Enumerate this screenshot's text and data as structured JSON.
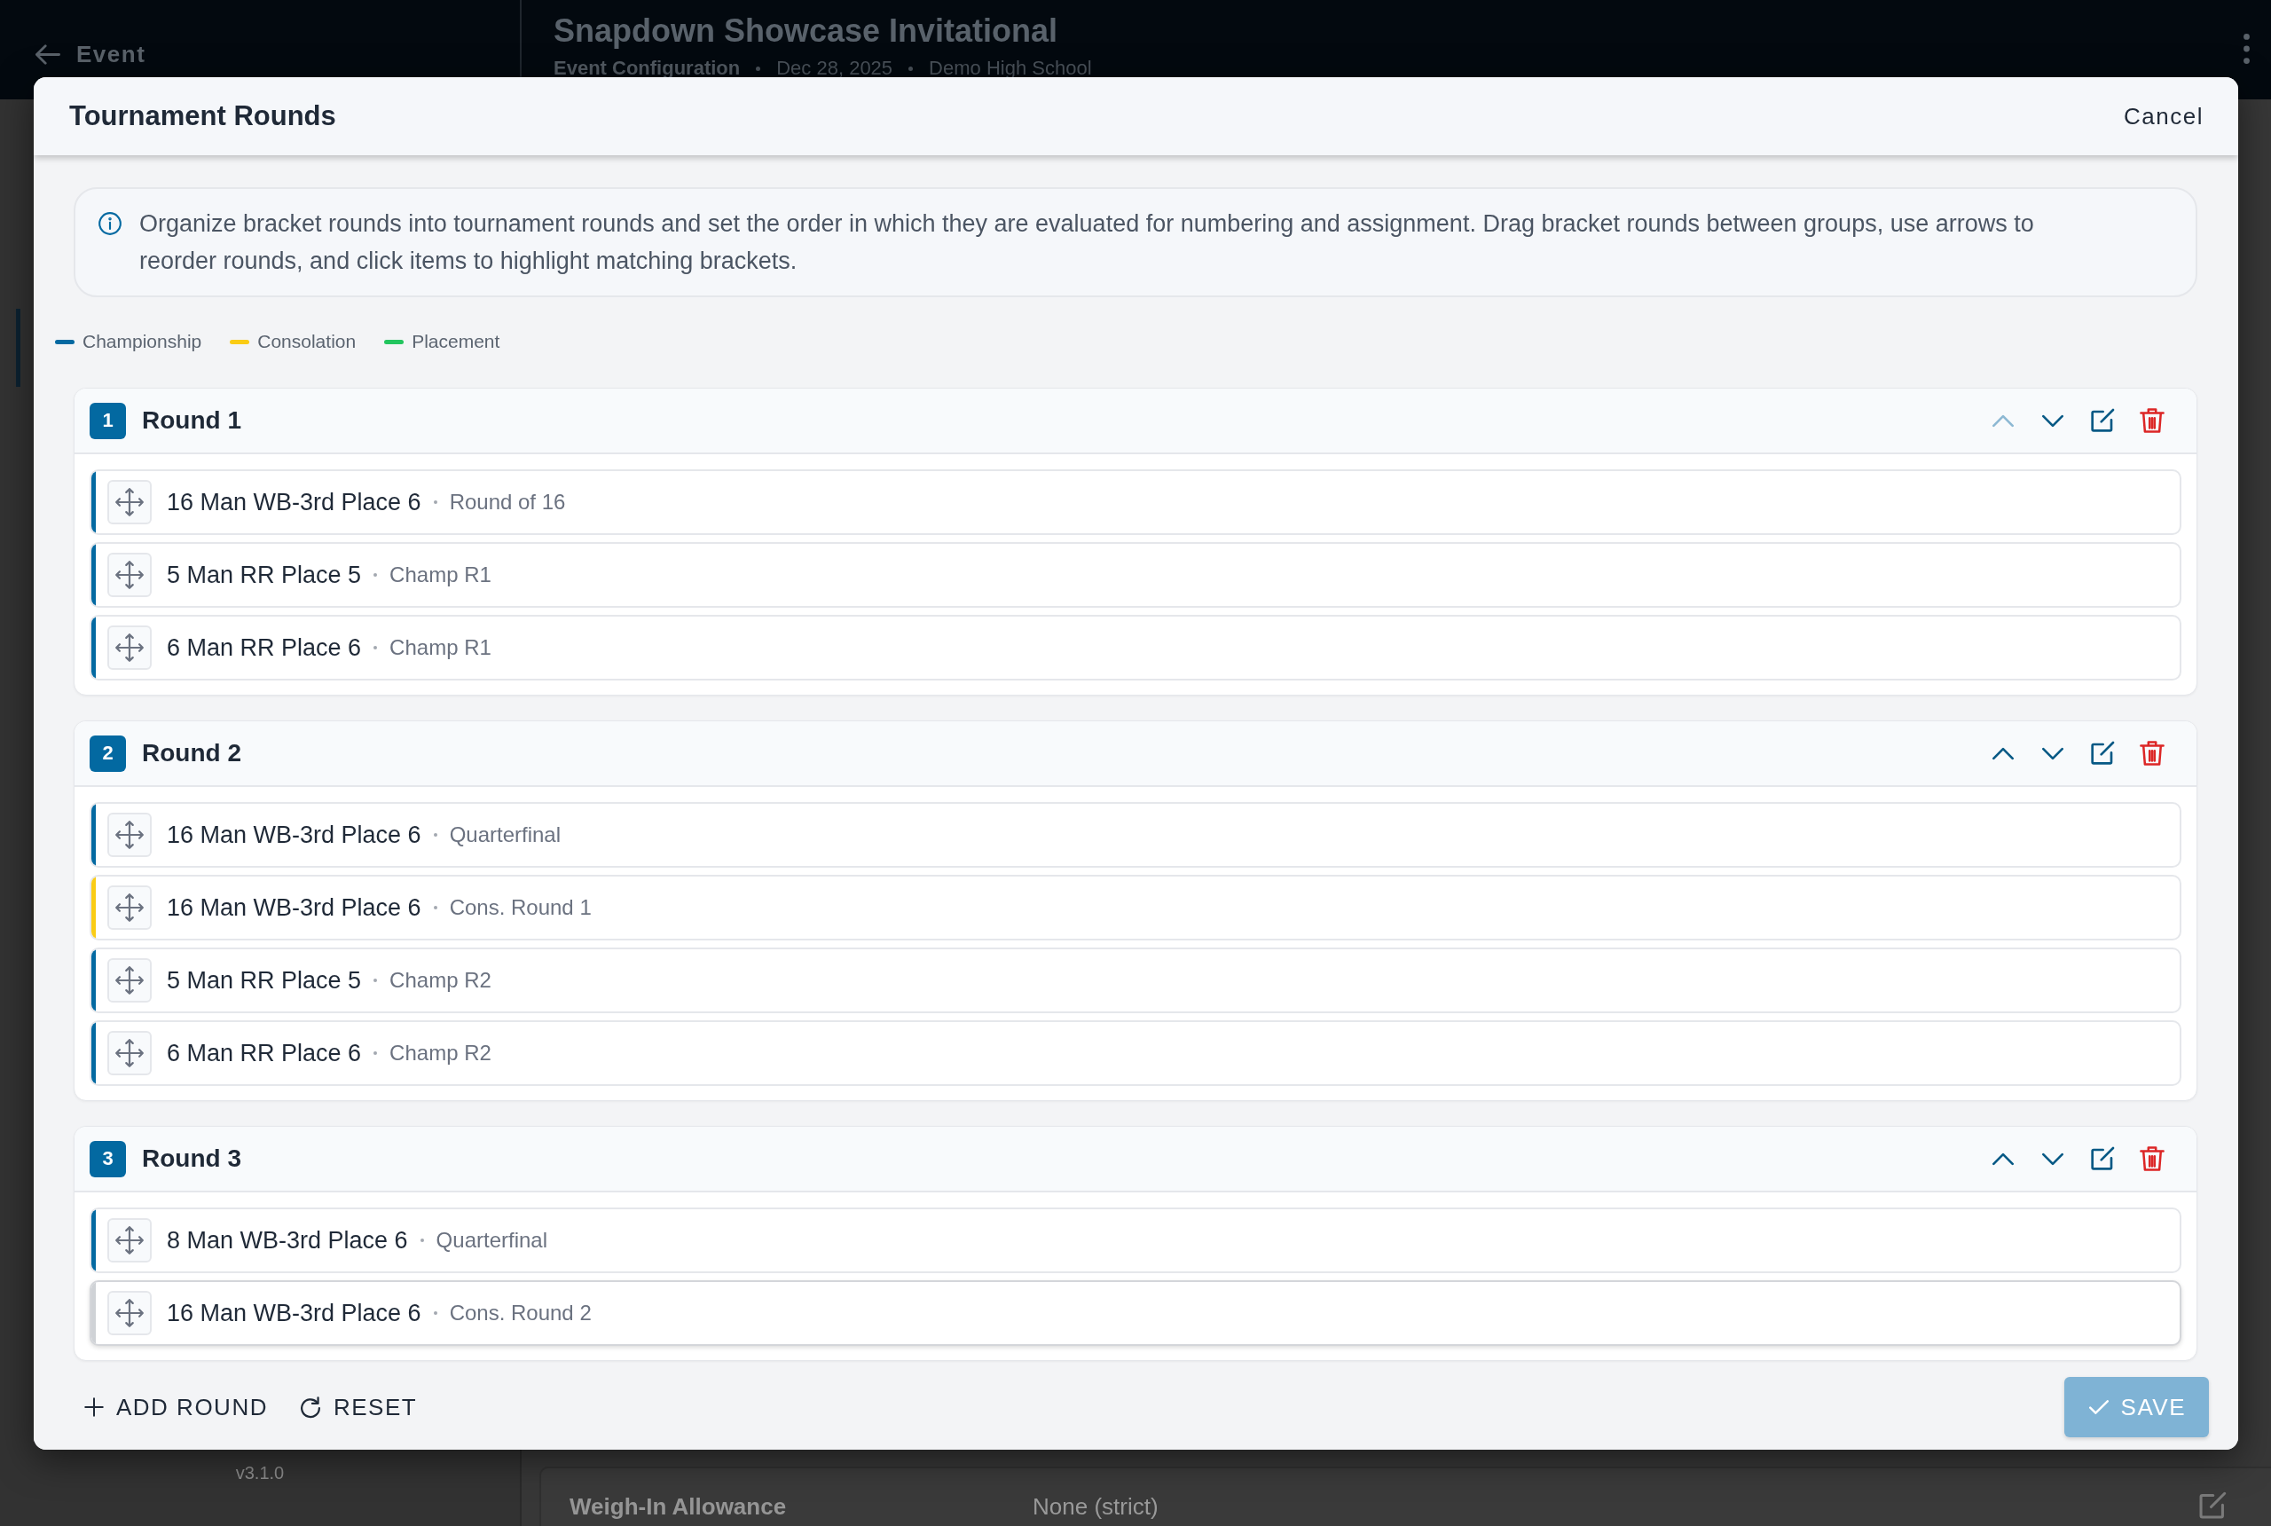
{
  "top_bar": {
    "back_label": "Event",
    "title": "Snapdown Showcase Invitational",
    "meta": [
      "Event Configuration",
      "Dec 28, 2025",
      "Demo High School"
    ]
  },
  "sidebar": {
    "version": "v3.1.0"
  },
  "settings": [
    {
      "label": "Weigh-In Allowance",
      "value": "None (strict)"
    }
  ],
  "dialog": {
    "title": "Tournament Rounds",
    "cancel": "Cancel",
    "info": "Organize bracket rounds into tournament rounds and set the order in which they are evaluated for numbering and assignment. Drag bracket rounds between groups, use arrows to reorder rounds, and click items to highlight matching brackets.",
    "legend": [
      {
        "label": "Championship",
        "color": "#0369a1"
      },
      {
        "label": "Consolation",
        "color": "#facc15"
      },
      {
        "label": "Placement",
        "color": "#22c55e"
      }
    ],
    "rounds": [
      {
        "number": "1",
        "title": "Round 1",
        "up_disabled": true,
        "down_disabled": false,
        "items": [
          {
            "name": "16 Man WB-3rd Place 6",
            "round": "Round of 16",
            "color": "#0369a1",
            "hovered": false
          },
          {
            "name": "5 Man RR Place 5",
            "round": "Champ R1",
            "color": "#0369a1",
            "hovered": false
          },
          {
            "name": "6 Man RR Place 6",
            "round": "Champ R1",
            "color": "#0369a1",
            "hovered": false
          }
        ]
      },
      {
        "number": "2",
        "title": "Round 2",
        "up_disabled": false,
        "down_disabled": false,
        "items": [
          {
            "name": "16 Man WB-3rd Place 6",
            "round": "Quarterfinal",
            "color": "#0369a1",
            "hovered": false
          },
          {
            "name": "16 Man WB-3rd Place 6",
            "round": "Cons. Round 1",
            "color": "#facc15",
            "hovered": false
          },
          {
            "name": "5 Man RR Place 5",
            "round": "Champ R2",
            "color": "#0369a1",
            "hovered": false
          },
          {
            "name": "6 Man RR Place 6",
            "round": "Champ R2",
            "color": "#0369a1",
            "hovered": false
          }
        ]
      },
      {
        "number": "3",
        "title": "Round 3",
        "up_disabled": false,
        "down_disabled": false,
        "items": [
          {
            "name": "8 Man WB-3rd Place 6",
            "round": "Quarterfinal",
            "color": "#0369a1",
            "hovered": false
          },
          {
            "name": "16 Man WB-3rd Place 6",
            "round": "Cons. Round 2",
            "color": "#cfd2d6",
            "hovered": true
          }
        ]
      }
    ],
    "footer": {
      "add_round": "ADD ROUND",
      "reset": "RESET",
      "save": {
        "label": "SAVE",
        "disabled": true
      }
    }
  }
}
